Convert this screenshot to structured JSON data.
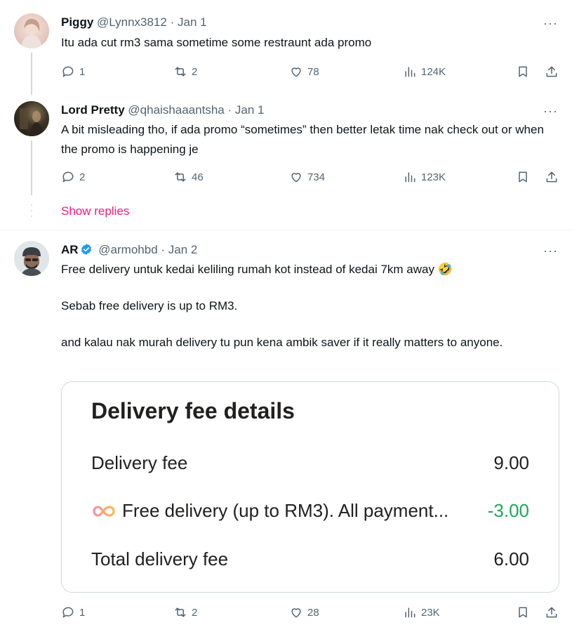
{
  "tweets": [
    {
      "name": "Piggy",
      "handle": "@Lynnx3812",
      "dot": "·",
      "date": "Jan 1",
      "text": "Itu ada cut rm3 sama sometime some restraunt ada promo",
      "replies": "1",
      "reposts": "2",
      "likes": "78",
      "views": "124K"
    },
    {
      "name": "Lord Pretty",
      "handle": "@qhaishaaantsha",
      "dot": "·",
      "date": "Jan 1",
      "text": "A bit misleading tho, if ada promo “sometimes” then better letak time nak check out or when the promo is happening je",
      "replies": "2",
      "reposts": "46",
      "likes": "734",
      "views": "123K"
    },
    {
      "name": "AR",
      "handle": "@armohbd",
      "dot": "·",
      "date": "Jan 2",
      "text_lines": [
        "Free delivery untuk kedai keliling rumah kot instead of kedai 7km away 🤣",
        "Sebab free delivery is up to RM3.",
        "and kalau nak murah delivery tu pun kena ambik saver if it really matters to anyone."
      ],
      "replies": "1",
      "reposts": "2",
      "likes": "28",
      "views": "23K"
    }
  ],
  "show_replies": "Show replies",
  "more_icon": "···",
  "card": {
    "title": "Delivery fee details",
    "rows": [
      {
        "label": "Delivery fee",
        "value": "9.00"
      },
      {
        "label": "Free delivery (up to RM3). All payment...",
        "value": "-3.00"
      },
      {
        "label": "Total delivery fee",
        "value": "6.00"
      }
    ]
  },
  "colors": {
    "accent_pink": "#f91880",
    "verified_blue": "#1d9bf0",
    "discount_green": "#1fa75a",
    "muted": "#536471"
  }
}
